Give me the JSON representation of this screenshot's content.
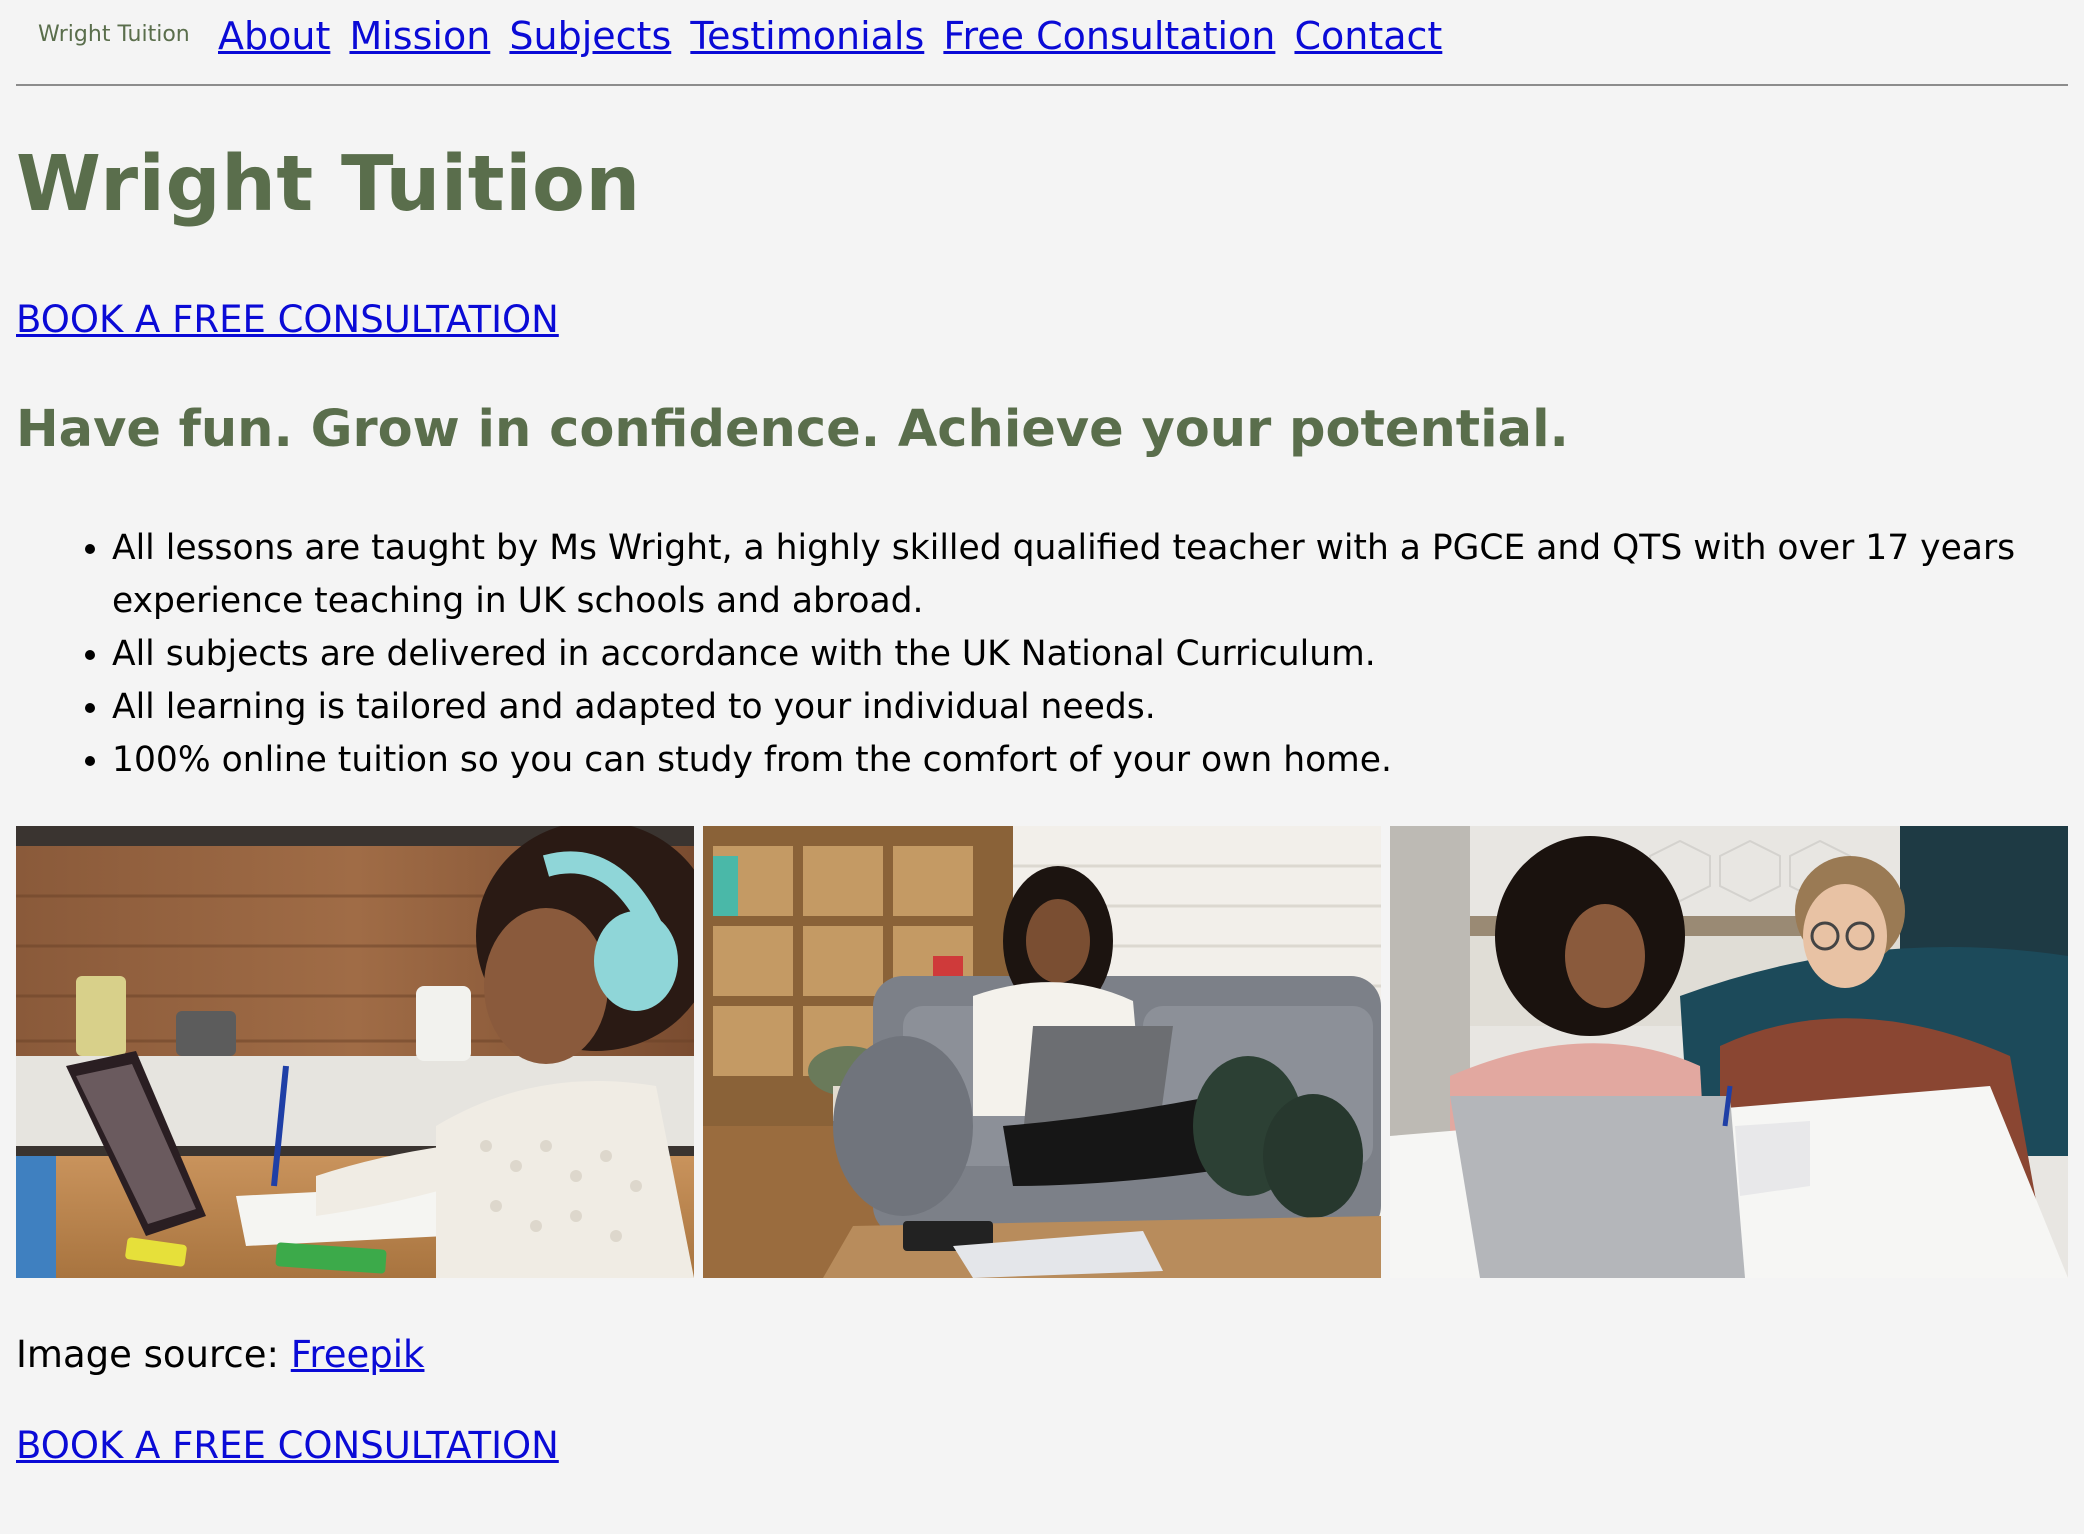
{
  "nav": {
    "brand": "Wright Tuition",
    "links": [
      "About",
      "Mission",
      "Subjects",
      "Testimonials",
      "Free Consultation",
      "Contact"
    ]
  },
  "hero": {
    "title": "Wright Tuition",
    "cta_top": "BOOK A FREE CONSULTATION",
    "tagline": "Have fun. Grow in confidence. Achieve your potential."
  },
  "bullets": [
    "All lessons are taught by Ms Wright, a highly skilled qualified teacher with a PGCE and QTS with over 17 years experience teaching in UK schools and abroad.",
    "All subjects are delivered in accordance with the UK National Curriculum.",
    "All learning is tailored and adapted to your individual needs.",
    "100% online tuition so you can study from the comfort of your own home."
  ],
  "credit": {
    "prefix": "Image source: ",
    "link": "Freepik"
  },
  "cta_bottom": "BOOK A FREE CONSULTATION",
  "colors": {
    "accent_green": "#5a6e4c",
    "link_blue": "#0a0ad6",
    "background": "#f4f4f4"
  }
}
